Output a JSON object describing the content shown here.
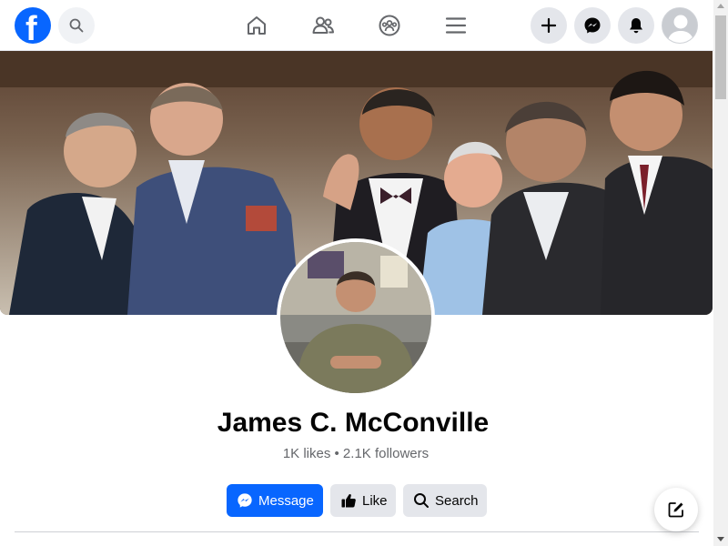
{
  "topbar": {
    "icons": [
      "facebook-logo",
      "search-icon",
      "home-icon",
      "friends-icon",
      "groups-icon",
      "menu-icon",
      "plus-icon",
      "messenger-icon",
      "bell-icon",
      "avatar"
    ]
  },
  "profile": {
    "name": "James C. McConville",
    "stats": "1K likes • 2.1K followers"
  },
  "actions": {
    "message_label": "Message",
    "like_label": "Like",
    "search_label": "Search"
  },
  "colors": {
    "brand": "#0866ff",
    "button_gray": "#e4e6eb",
    "secondary_text": "#65676b"
  }
}
